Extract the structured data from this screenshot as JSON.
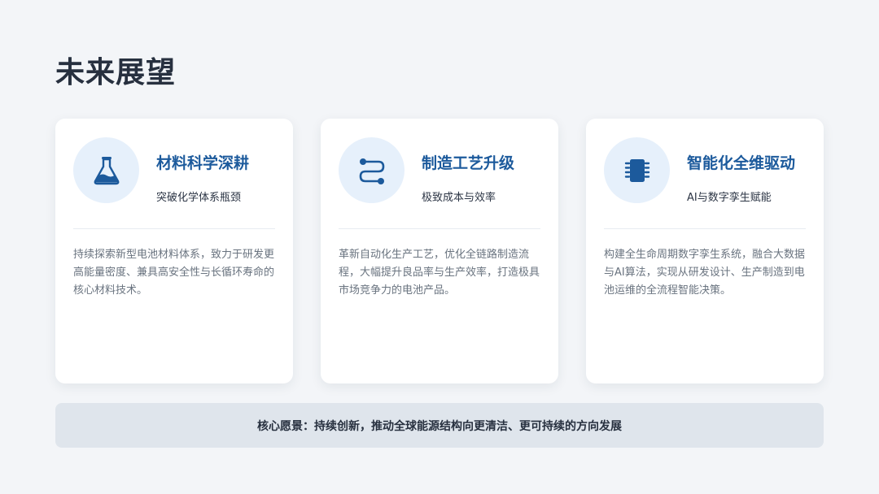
{
  "page": {
    "title": "未来展望"
  },
  "cards": [
    {
      "icon": "flask-icon",
      "title": "材料科学深耕",
      "subtitle": "突破化学体系瓶颈",
      "description": "持续探索新型电池材料体系，致力于研发更高能量密度、兼具高安全性与长循环寿命的核心材料技术。"
    },
    {
      "icon": "process-flow-icon",
      "title": "制造工艺升级",
      "subtitle": "极致成本与效率",
      "description": "革新自动化生产工艺，优化全链路制造流程，大幅提升良品率与生产效率，打造极具市场竞争力的电池产品。"
    },
    {
      "icon": "chip-icon",
      "title": "智能化全维驱动",
      "subtitle": "AI与数字孪生赋能",
      "description": "构建全生命周期数字孪生系统，融合大数据与AI算法，实现从研发设计、生产制造到电池运维的全流程智能决策。"
    }
  ],
  "banner": {
    "text": "核心愿景：持续创新，推动全球能源结构向更清洁、更可持续的方向发展"
  },
  "colors": {
    "background": "#f3f5f8",
    "accent": "#1c5a9c",
    "icon_bg": "#e6f0fb",
    "banner_bg": "#dfe5ec"
  }
}
